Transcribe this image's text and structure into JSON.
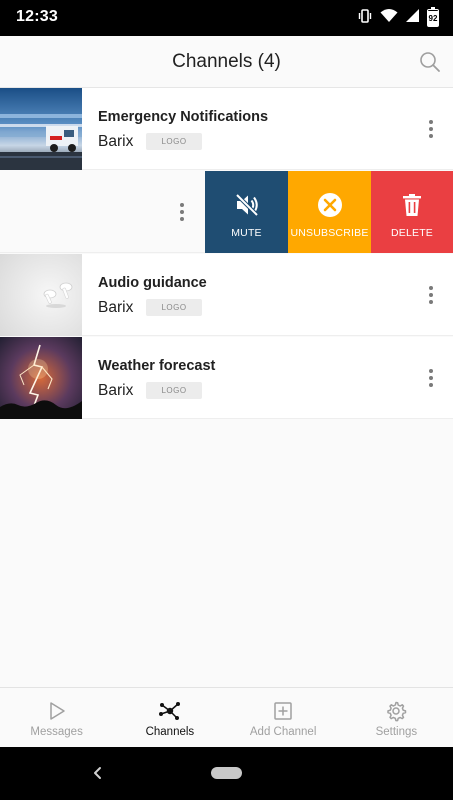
{
  "status_bar": {
    "time": "12:33",
    "battery": "92",
    "icons": [
      "vibrate-icon",
      "wifi-icon",
      "signal-icon",
      "battery-icon"
    ]
  },
  "header": {
    "title": "Channels (4)",
    "search_icon": "search-icon"
  },
  "channels": [
    {
      "name": "Emergency Notifications",
      "provider": "Barix",
      "logo": "LOGO"
    },
    {
      "name": "",
      "provider": "",
      "logo": ""
    },
    {
      "name": "Audio guidance",
      "provider": "Barix",
      "logo": "LOGO"
    },
    {
      "name": "Weather forecast",
      "provider": "Barix",
      "logo": "LOGO"
    }
  ],
  "swipe_actions": {
    "mute": "MUTE",
    "unsubscribe": "UNSUBSCRIBE",
    "delete": "DELETE"
  },
  "bottom_nav": {
    "items": [
      {
        "label": "Messages",
        "icon": "play-icon",
        "active": false
      },
      {
        "label": "Channels",
        "icon": "network-icon",
        "active": true
      },
      {
        "label": "Add Channel",
        "icon": "add-box-icon",
        "active": false
      },
      {
        "label": "Settings",
        "icon": "gear-icon",
        "active": false
      }
    ]
  },
  "colors": {
    "mute_action": "#1f4d72",
    "unsubscribe_action": "#ffa800",
    "delete_action": "#ea3f42",
    "active_nav": "#111111",
    "inactive_nav": "#a0a0a0"
  }
}
